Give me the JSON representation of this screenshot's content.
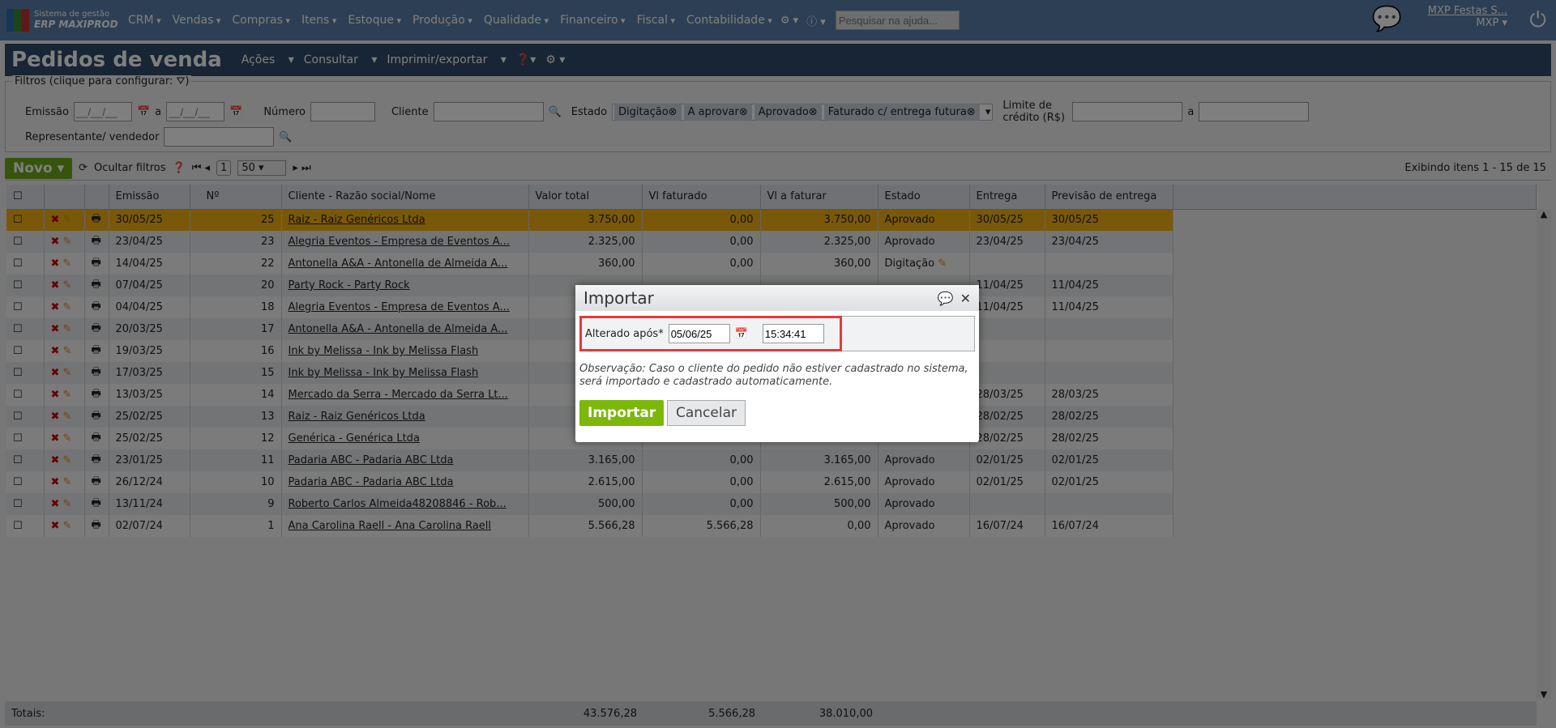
{
  "app": {
    "logo_line1": "Sistema de gestão",
    "logo_line2": "ERP MAXIPROD",
    "menu": [
      "CRM",
      "Vendas",
      "Compras",
      "Itens",
      "Estoque",
      "Produção",
      "Qualidade",
      "Financeiro",
      "Fiscal",
      "Contabilidade"
    ],
    "help_search_placeholder": "Pesquisar na ajuda...",
    "user_company": "MXP Festas S...",
    "user_short": "MXP"
  },
  "page": {
    "title": "Pedidos de venda",
    "actions": [
      "Ações",
      "Consultar",
      "Imprimir/exportar"
    ]
  },
  "filters": {
    "legend": "Filtros (clique para configurar:",
    "emissao": "Emissão",
    "date_placeholder": "__/__/__",
    "a": "a",
    "numero": "Número",
    "cliente": "Cliente",
    "estado": "Estado",
    "estado_chips": [
      "Digitação",
      "A aprovar",
      "Aprovado",
      "Faturado c/ entrega futura"
    ],
    "limite": "Limite de crédito (R$)",
    "representante": "Representante/ vendedor"
  },
  "toolbar": {
    "novo": "Novo",
    "ocultar": "Ocultar filtros",
    "page": "1",
    "page_size": "50",
    "info": "Exibindo itens 1 - 15 de 15"
  },
  "table": {
    "headers": [
      "Emissão",
      "Nº",
      "Cliente - Razão social/Nome",
      "Valor total",
      "Vl faturado",
      "Vl a faturar",
      "Estado",
      "Entrega",
      "Previsão de entrega"
    ],
    "rows": [
      [
        "30/05/25",
        "25",
        "Raiz - Raiz Genéricos Ltda",
        "3.750,00",
        "0,00",
        "3.750,00",
        "Aprovado",
        "30/05/25",
        "30/05/25"
      ],
      [
        "23/04/25",
        "23",
        "Alegria Eventos - Empresa de Eventos A...",
        "2.325,00",
        "0,00",
        "2.325,00",
        "Aprovado",
        "23/04/25",
        "23/04/25"
      ],
      [
        "14/04/25",
        "22",
        "Antonella A&A - Antonella de Almeida A...",
        "360,00",
        "0,00",
        "360,00",
        "Digitação",
        "",
        ""
      ],
      [
        "07/04/25",
        "20",
        "Party Rock - Party Rock",
        "",
        "",
        "",
        "",
        "11/04/25",
        "11/04/25"
      ],
      [
        "04/04/25",
        "18",
        "Alegria Eventos - Empresa de Eventos A...",
        "",
        "",
        "",
        "",
        "11/04/25",
        "11/04/25"
      ],
      [
        "20/03/25",
        "17",
        "Antonella A&A - Antonella de Almeida A...",
        "",
        "",
        "",
        "",
        "",
        ""
      ],
      [
        "19/03/25",
        "16",
        "Ink by Melissa - Ink by Melissa Flash",
        "",
        "",
        "",
        "",
        "",
        ""
      ],
      [
        "17/03/25",
        "15",
        "Ink by Melissa - Ink by Melissa Flash",
        "",
        "",
        "",
        "",
        "",
        ""
      ],
      [
        "13/03/25",
        "14",
        "Mercado da Serra - Mercado da Serra Lt...",
        "",
        "",
        "",
        "",
        "28/03/25",
        "28/03/25"
      ],
      [
        "25/02/25",
        "13",
        "Raiz - Raiz Genéricos Ltda",
        "",
        "",
        "",
        "",
        "28/02/25",
        "28/02/25"
      ],
      [
        "25/02/25",
        "12",
        "Genérica - Genérica Ltda",
        "",
        "",
        "",
        "",
        "28/02/25",
        "28/02/25"
      ],
      [
        "23/01/25",
        "11",
        "Padaria ABC - Padaria ABC Ltda",
        "3.165,00",
        "0,00",
        "3.165,00",
        "Aprovado",
        "02/01/25",
        "02/01/25"
      ],
      [
        "26/12/24",
        "10",
        "Padaria ABC - Padaria ABC Ltda",
        "2.615,00",
        "0,00",
        "2.615,00",
        "Aprovado",
        "02/01/25",
        "02/01/25"
      ],
      [
        "13/11/24",
        "9",
        "Roberto Carlos Almeida48208846 - Rob...",
        "500,00",
        "0,00",
        "500,00",
        "Aprovado",
        "",
        ""
      ],
      [
        "02/07/24",
        "1",
        "Ana Carolina Raell - Ana Carolina Raell",
        "5.566,28",
        "5.566,28",
        "0,00",
        "Aprovado",
        "16/07/24",
        "16/07/24"
      ]
    ],
    "totals_label": "Totais:",
    "totals": [
      "43.576,28",
      "5.566,28",
      "38.010,00"
    ]
  },
  "modal": {
    "title": "Importar",
    "field_label": "Alterado após*",
    "date": "05/06/25",
    "time": "15:34:41",
    "note": "Observação: Caso o cliente do pedido não estiver cadastrado no sistema, será importado e cadastrado automaticamente.",
    "import": "Importar",
    "cancel": "Cancelar"
  },
  "colors": {
    "topbar": "#5b7ea8",
    "selected_row": "#f2b313",
    "import_button": "#7cb80a",
    "highlight": "#e53a3a"
  }
}
